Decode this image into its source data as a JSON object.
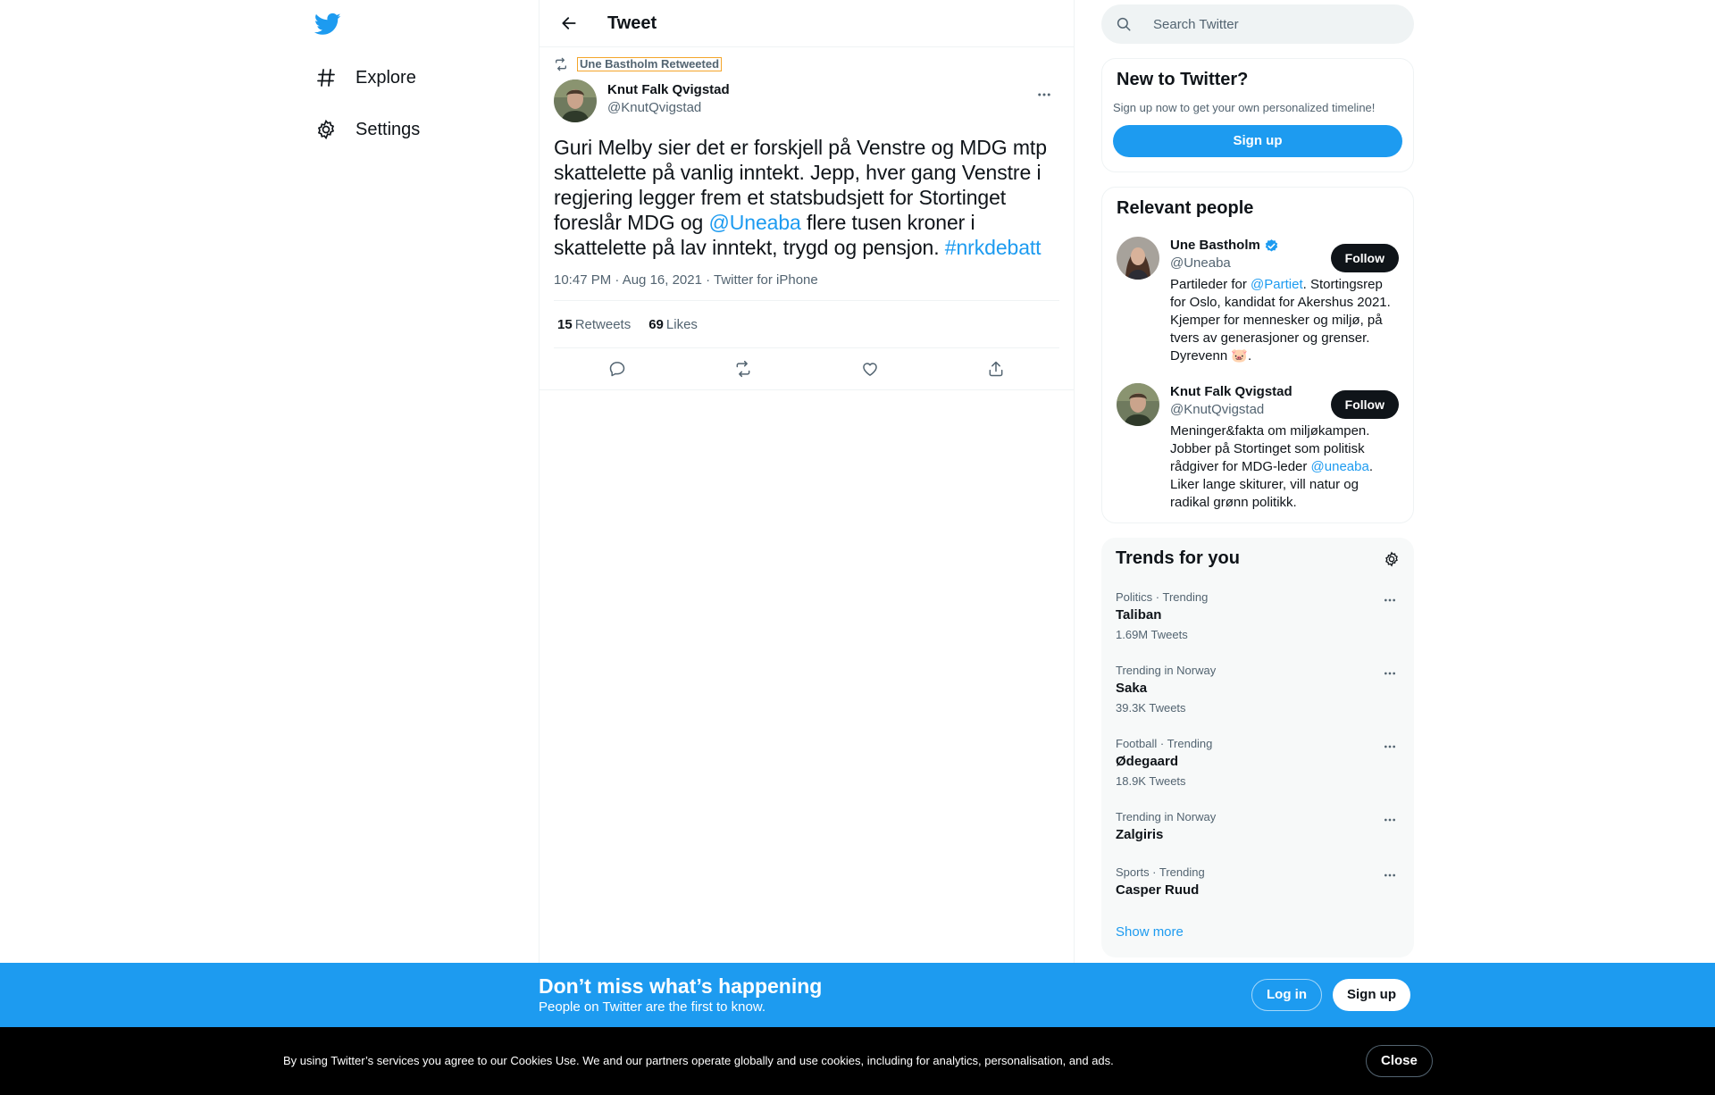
{
  "nav": {
    "explore": "Explore",
    "settings": "Settings"
  },
  "header": {
    "title": "Tweet"
  },
  "tweet": {
    "retweeted_by": "Une Bastholm Retweeted",
    "author_name": "Knut Falk Qvigstad",
    "author_handle": "@KnutQvigstad",
    "text_part1": "Guri Melby sier det er forskjell på Venstre og MDG mtp skattelette på vanlig inntekt. Jepp, hver gang Venstre i regjering legger frem et statsbudsjett for Stortinget foreslår MDG og ",
    "mention": "@Uneaba",
    "text_part2": " flere tusen kroner i skattelette på lav inntekt, trygd og pensjon. ",
    "hashtag": "#nrkdebatt",
    "time": "10:47 PM · Aug 16, 2021 · Twitter for iPhone",
    "retweets_count": "15",
    "retweets_label": "Retweets",
    "likes_count": "69",
    "likes_label": "Likes"
  },
  "search": {
    "placeholder": "Search Twitter"
  },
  "new_to_twitter": {
    "title": "New to Twitter?",
    "subtitle": "Sign up now to get your own personalized timeline!",
    "signup": "Sign up"
  },
  "relevant_people": {
    "title": "Relevant people",
    "people": [
      {
        "name": "Une Bastholm",
        "handle": "@Uneaba",
        "follow": "Follow",
        "bio_pre": "Partileder for ",
        "bio_link": "@Partiet",
        "bio_post": ". Stortingsrep for Oslo, kandidat for Akershus 2021. Kjemper for mennesker og miljø, på tvers av generasjoner og grenser. Dyrevenn 🐷."
      },
      {
        "name": "Knut Falk Qvigstad",
        "handle": "@KnutQvigstad",
        "follow": "Follow",
        "bio_pre": "Meninger&fakta om miljøkampen. Jobber på Stortinget som politisk rådgiver for MDG-leder ",
        "bio_link": "@uneaba",
        "bio_post": ". Liker lange skiturer, vill natur og radikal grønn politikk."
      }
    ]
  },
  "trends": {
    "title": "Trends for you",
    "items": [
      {
        "context": "Politics · Trending",
        "name": "Taliban",
        "count": "1.69M Tweets"
      },
      {
        "context": "Trending in Norway",
        "name": "Saka",
        "count": "39.3K Tweets"
      },
      {
        "context": "Football · Trending",
        "name": "Ødegaard",
        "count": "18.9K Tweets"
      },
      {
        "context": "Trending in Norway",
        "name": "Zalgiris",
        "count": ""
      },
      {
        "context": "Sports · Trending",
        "name": "Casper Ruud",
        "count": ""
      }
    ],
    "show_more": "Show more"
  },
  "promo": {
    "title": "Don’t miss what’s happening",
    "subtitle": "People on Twitter are the first to know.",
    "login": "Log in",
    "signup": "Sign up"
  },
  "cookie": {
    "text": "By using Twitter’s services you agree to our Cookies Use. We and our partners operate globally and use cookies, including for analytics, personalisation, and ads.",
    "close": "Close"
  },
  "colors": {
    "brand": "#1d9bf0",
    "text": "#0f1419",
    "muted": "#536471",
    "border": "#eff3f4"
  }
}
